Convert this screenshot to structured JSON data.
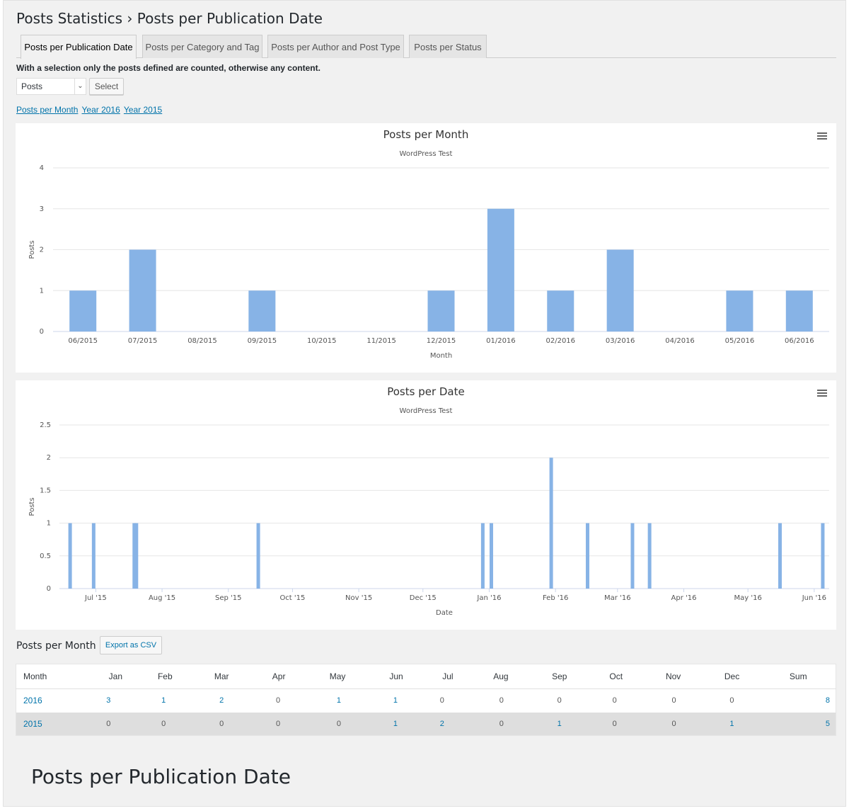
{
  "page": {
    "title": "Posts Statistics › Posts per Publication Date",
    "note": "With a selection only the posts defined are counted, otherwise any content.",
    "select_value": "Posts",
    "select_button": "Select",
    "links": [
      "Posts per Month",
      "Year 2016",
      "Year 2015"
    ],
    "caption": "Posts per Publication Date"
  },
  "tabs": [
    {
      "label": "Posts per Publication Date",
      "active": true
    },
    {
      "label": "Posts per Category and Tag",
      "active": false
    },
    {
      "label": "Posts per Author and Post Type",
      "active": false
    },
    {
      "label": "Posts per Status",
      "active": false
    }
  ],
  "colors": {
    "bar": "#87b3e6",
    "link": "#0073aa"
  },
  "chart_data": [
    {
      "type": "bar",
      "title": "Posts per Month",
      "subtitle": "WordPress Test",
      "xlabel": "Month",
      "ylabel": "Posts",
      "ylim": [
        0,
        4
      ],
      "yticks": [
        0,
        1,
        2,
        3,
        4
      ],
      "categories": [
        "06/2015",
        "07/2015",
        "08/2015",
        "09/2015",
        "10/2015",
        "11/2015",
        "12/2015",
        "01/2016",
        "02/2016",
        "03/2016",
        "04/2016",
        "05/2016",
        "06/2016"
      ],
      "values": [
        1,
        2,
        0,
        1,
        0,
        0,
        1,
        3,
        1,
        2,
        0,
        1,
        1
      ],
      "grid": true,
      "menu_icon": "hamburger-icon"
    },
    {
      "type": "bar",
      "title": "Posts per Date",
      "subtitle": "WordPress Test",
      "xlabel": "Date",
      "ylabel": "Posts",
      "ylim": [
        0,
        2.5
      ],
      "yticks": [
        "0",
        "0.5",
        "1",
        "1.5",
        "2",
        "2.5"
      ],
      "xlim": [
        "2015-06-14",
        "2016-06-08"
      ],
      "xticks": [
        {
          "date": "2015-07-01",
          "label": "Jul '15"
        },
        {
          "date": "2015-08-01",
          "label": "Aug '15"
        },
        {
          "date": "2015-09-01",
          "label": "Sep '15"
        },
        {
          "date": "2015-10-01",
          "label": "Oct '15"
        },
        {
          "date": "2015-11-01",
          "label": "Nov '15"
        },
        {
          "date": "2015-12-01",
          "label": "Dec '15"
        },
        {
          "date": "2016-01-01",
          "label": "Jan '16"
        },
        {
          "date": "2016-02-01",
          "label": "Feb '16"
        },
        {
          "date": "2016-03-01",
          "label": "Mar '16"
        },
        {
          "date": "2016-04-01",
          "label": "Apr '16"
        },
        {
          "date": "2016-05-01",
          "label": "May '16"
        },
        {
          "date": "2016-06-01",
          "label": "Jun '16"
        }
      ],
      "points": [
        {
          "date": "2015-06-19",
          "value": 1
        },
        {
          "date": "2015-06-30",
          "value": 1
        },
        {
          "date": "2015-07-19",
          "value": 1
        },
        {
          "date": "2015-07-20",
          "value": 1
        },
        {
          "date": "2015-09-15",
          "value": 1
        },
        {
          "date": "2015-12-29",
          "value": 1
        },
        {
          "date": "2016-01-02",
          "value": 1
        },
        {
          "date": "2016-01-30",
          "value": 2
        },
        {
          "date": "2016-02-16",
          "value": 1
        },
        {
          "date": "2016-03-08",
          "value": 1
        },
        {
          "date": "2016-03-16",
          "value": 1
        },
        {
          "date": "2016-05-16",
          "value": 1
        },
        {
          "date": "2016-06-05",
          "value": 1
        }
      ],
      "grid": true,
      "menu_icon": "hamburger-icon"
    }
  ],
  "table": {
    "heading": "Posts per Month",
    "export_label": "Export as CSV",
    "columns": [
      "Month",
      "Jan",
      "Feb",
      "Mar",
      "Apr",
      "May",
      "Jun",
      "Jul",
      "Aug",
      "Sep",
      "Oct",
      "Nov",
      "Dec",
      "Sum"
    ],
    "rows": [
      {
        "year": "2016",
        "values": [
          "3",
          "1",
          "2",
          "0",
          "1",
          "1",
          "0",
          "0",
          "0",
          "0",
          "0",
          "0",
          "8"
        ]
      },
      {
        "year": "2015",
        "values": [
          "0",
          "0",
          "0",
          "0",
          "0",
          "1",
          "2",
          "0",
          "1",
          "0",
          "0",
          "1",
          "5"
        ]
      }
    ]
  }
}
